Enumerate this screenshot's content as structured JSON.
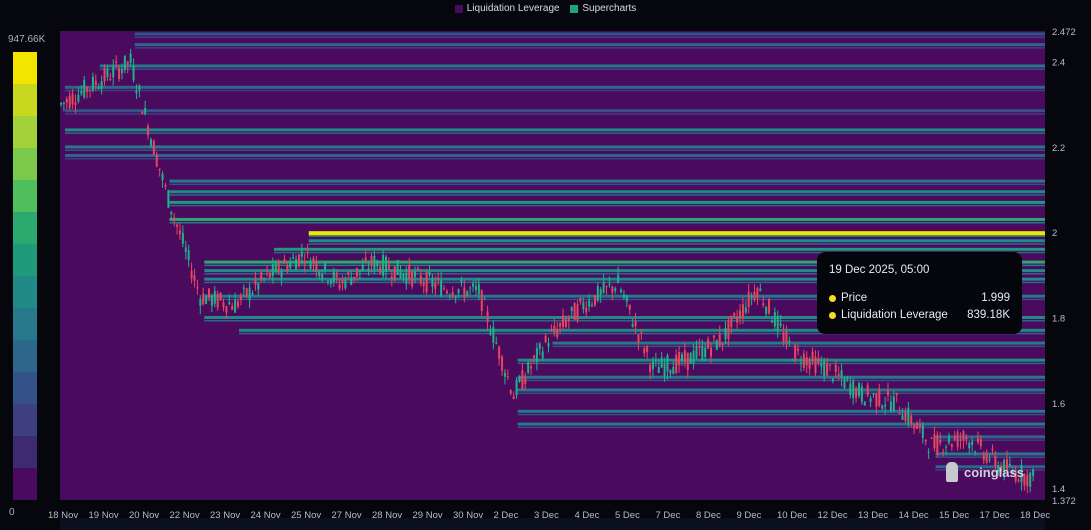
{
  "legend": {
    "items": [
      {
        "label": "Liquidation Leverage",
        "color": "#4a0a5e"
      },
      {
        "label": "Supercharts",
        "color": "#1fa37a"
      }
    ]
  },
  "colorbar": {
    "max_label": "947.66K",
    "min_label": "0",
    "colors": [
      "#f2e600",
      "#c8d81e",
      "#a3d13a",
      "#7cc84a",
      "#4fbe5c",
      "#2ba86e",
      "#1f9a7a",
      "#208a86",
      "#27788a",
      "#2c668a",
      "#34528a",
      "#3d3f80",
      "#3e2a70",
      "#4a0a5e"
    ]
  },
  "tooltip": {
    "title": "19 Dec 2025, 05:00",
    "price_label": "Price",
    "price_value": "1.999",
    "lev_label": "Liquidation Leverage",
    "lev_value": "839.18K"
  },
  "watermark": "coinglass",
  "chart_data": {
    "type": "heatmap",
    "title": "Liquidation Leverage",
    "xlabel": "",
    "ylabel": "",
    "ylim": [
      1.372,
      2.472
    ],
    "y_ticks": [
      "2.472",
      "2.4",
      "2.2",
      "2",
      "1.8",
      "1.6",
      "1.4",
      "1.372"
    ],
    "y_tick_values": [
      2.472,
      2.4,
      2.2,
      2.0,
      1.8,
      1.6,
      1.4,
      1.372
    ],
    "x_ticks": [
      "18 Nov",
      "19 Nov",
      "20 Nov",
      "22 Nov",
      "23 Nov",
      "24 Nov",
      "25 Nov",
      "27 Nov",
      "28 Nov",
      "29 Nov",
      "30 Nov",
      "2 Dec",
      "3 Dec",
      "4 Dec",
      "5 Dec",
      "7 Dec",
      "8 Dec",
      "9 Dec",
      "10 Dec",
      "12 Dec",
      "13 Dec",
      "14 Dec",
      "15 Dec",
      "17 Dec",
      "18 Dec"
    ],
    "price_path": [
      2.3,
      2.35,
      2.4,
      2.1,
      1.85,
      1.83,
      1.9,
      1.95,
      1.88,
      1.93,
      1.9,
      1.87,
      1.86,
      1.62,
      1.75,
      1.83,
      1.88,
      1.68,
      1.7,
      1.75,
      1.87,
      1.72,
      1.68,
      1.62,
      1.6,
      1.5,
      1.52,
      1.45,
      1.42
    ],
    "bands": [
      [
        2.465,
        0.25
      ],
      [
        2.44,
        0.3
      ],
      [
        2.39,
        0.35
      ],
      [
        2.34,
        0.3
      ],
      [
        2.285,
        0.25
      ],
      [
        2.24,
        0.45
      ],
      [
        2.2,
        0.4
      ],
      [
        2.18,
        0.3
      ],
      [
        2.12,
        0.35
      ],
      [
        2.095,
        0.45
      ],
      [
        2.07,
        0.55
      ],
      [
        2.03,
        0.6
      ],
      [
        1.999,
        1.0
      ],
      [
        1.98,
        0.5
      ],
      [
        1.96,
        0.55
      ],
      [
        1.93,
        0.6
      ],
      [
        1.91,
        0.5
      ],
      [
        1.89,
        0.45
      ],
      [
        1.85,
        0.4
      ],
      [
        1.8,
        0.45
      ],
      [
        1.77,
        0.5
      ],
      [
        1.74,
        0.4
      ],
      [
        1.7,
        0.45
      ],
      [
        1.66,
        0.4
      ],
      [
        1.63,
        0.35
      ],
      [
        1.58,
        0.35
      ],
      [
        1.55,
        0.4
      ],
      [
        1.52,
        0.3
      ],
      [
        1.48,
        0.35
      ],
      [
        1.45,
        0.3
      ]
    ]
  }
}
